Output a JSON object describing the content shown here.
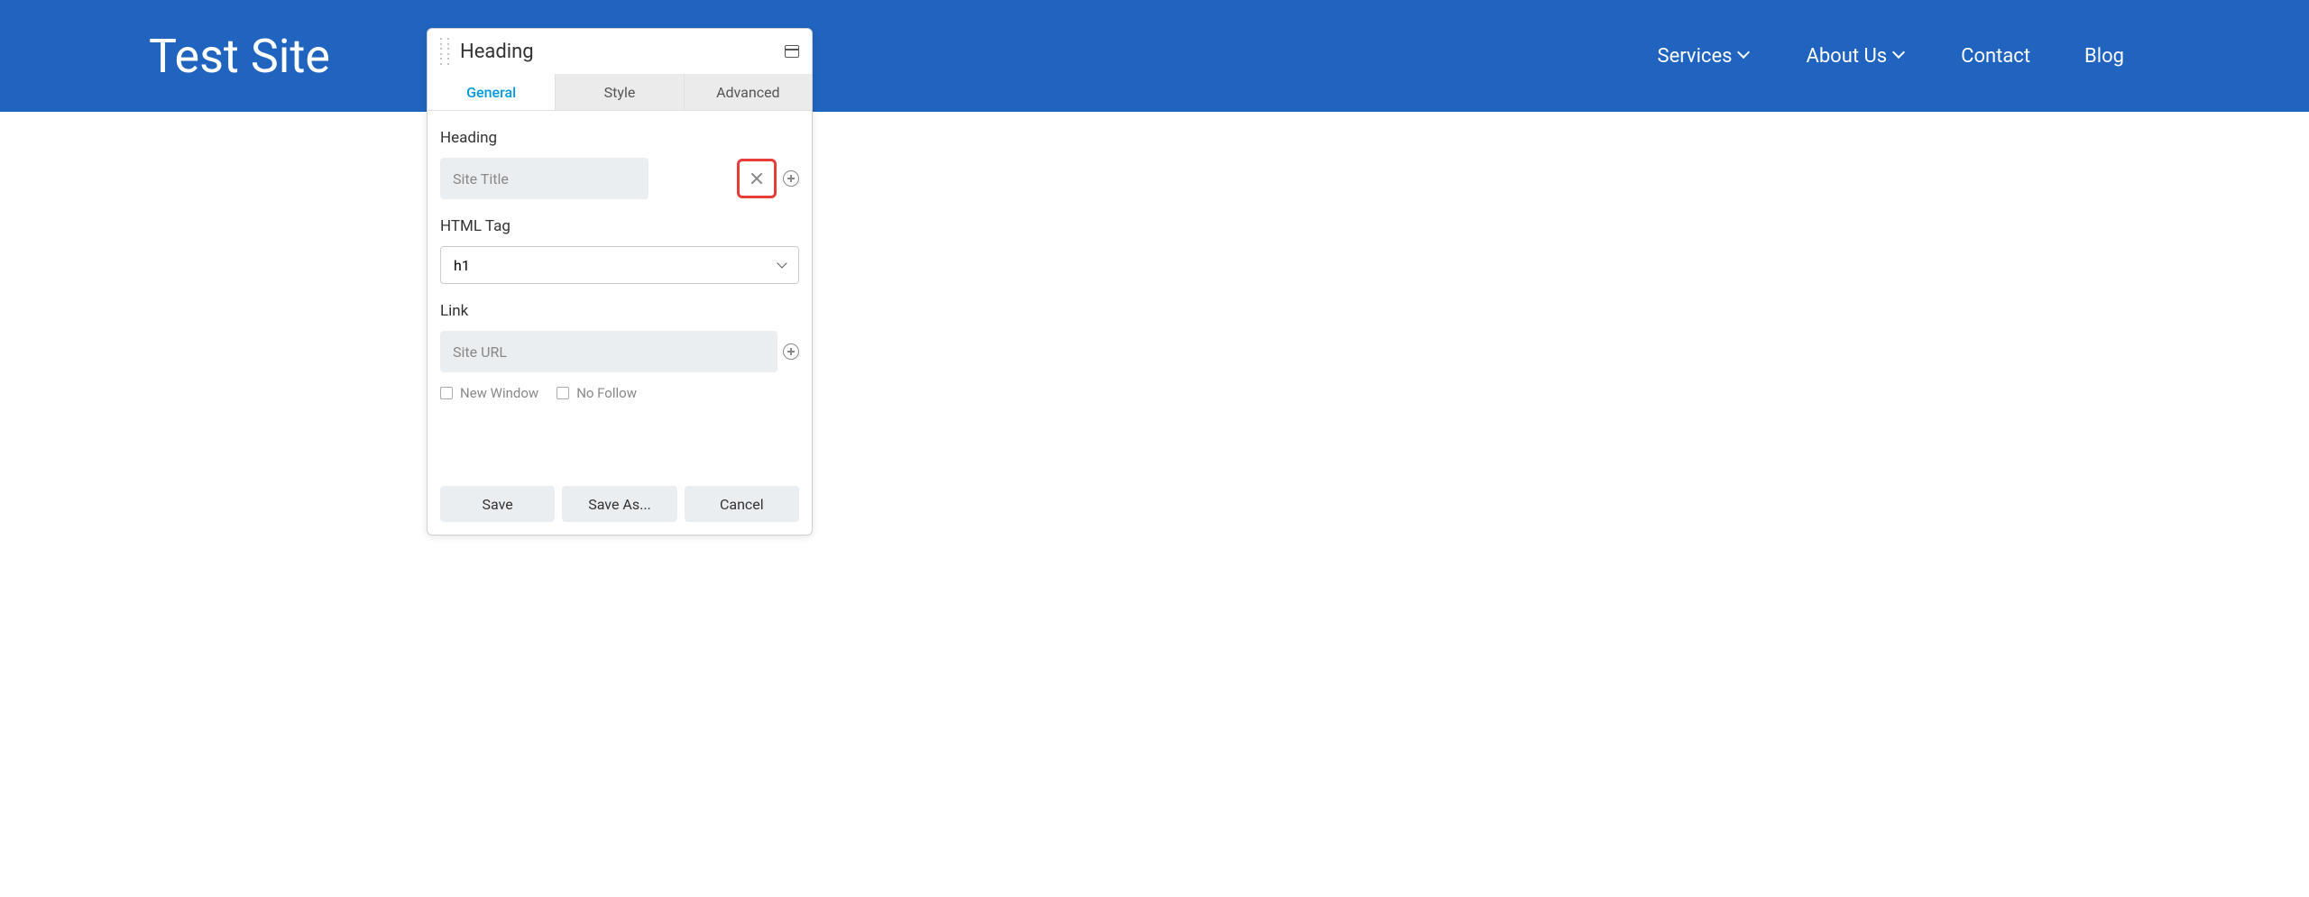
{
  "header": {
    "site_title": "Test Site",
    "nav": [
      {
        "label": "Services",
        "has_dropdown": true
      },
      {
        "label": "About Us",
        "has_dropdown": true
      },
      {
        "label": "Contact",
        "has_dropdown": false
      },
      {
        "label": "Blog",
        "has_dropdown": false
      }
    ]
  },
  "panel": {
    "title": "Heading",
    "tabs": {
      "general": "General",
      "style": "Style",
      "advanced": "Advanced"
    },
    "fields": {
      "heading_label": "Heading",
      "heading_placeholder": "Site Title",
      "heading_value": "",
      "html_tag_label": "HTML Tag",
      "html_tag_value": "h1",
      "link_label": "Link",
      "link_placeholder": "Site URL",
      "link_value": "",
      "new_window_label": "New Window",
      "no_follow_label": "No Follow"
    },
    "footer": {
      "save": "Save",
      "save_as": "Save As...",
      "cancel": "Cancel"
    }
  }
}
